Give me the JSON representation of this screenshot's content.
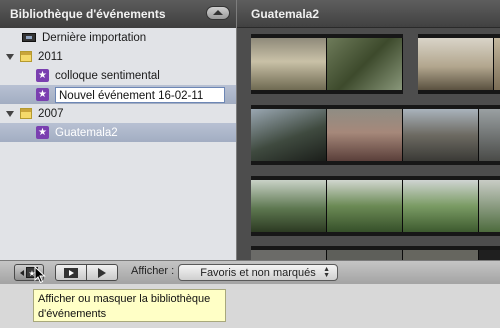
{
  "sidebar": {
    "title": "Bibliothèque d'événements",
    "items": [
      {
        "label": "Dernière importation"
      },
      {
        "label": "2011"
      },
      {
        "label": "colloque sentimental"
      },
      {
        "edit_value": "Nouvel événement 16-02-11"
      },
      {
        "label": "2007"
      },
      {
        "label": "Guatemala2"
      }
    ]
  },
  "main": {
    "title": "Guatemala2"
  },
  "toolbar": {
    "afficher_label": "Afficher :",
    "filter_value": "Favoris et non marqués"
  },
  "tooltip": {
    "text_line1": "Afficher ou masquer la bibliothèque",
    "text_line2": "d'événements"
  },
  "colors": {
    "selection": "#a9b4c8",
    "event_star": "#7a3fb0",
    "tooltip_bg": "#ffffc6"
  }
}
